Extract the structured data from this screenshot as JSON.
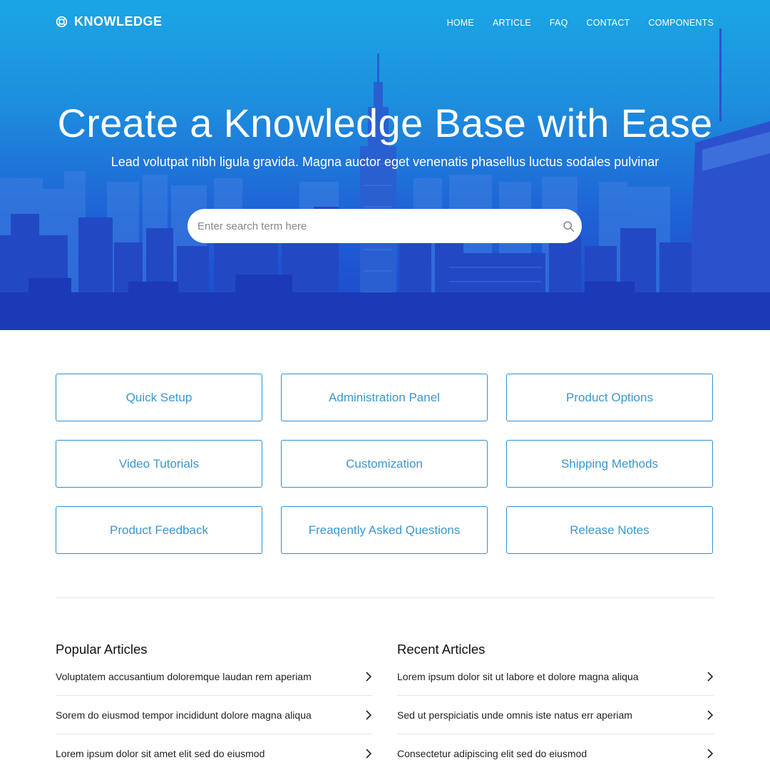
{
  "brand": {
    "name": "KNOWLEDGE"
  },
  "nav": {
    "items": [
      "HOME",
      "ARTICLE",
      "FAQ",
      "CONTACT",
      "COMPONENTS"
    ]
  },
  "hero": {
    "title": "Create a Knowledge Base with Ease",
    "subtitle": "Lead volutpat nibh ligula gravida. Magna auctor eget venenatis phasellus luctus sodales pulvinar",
    "search_placeholder": "Enter search term here"
  },
  "categories": [
    "Quick Setup",
    "Administration Panel",
    "Product Options",
    "Video Tutorials",
    "Customization",
    "Shipping Methods",
    "Product Feedback",
    "Freaqently Asked Questions",
    "Release Notes"
  ],
  "popular": {
    "title": "Popular Articles",
    "items": [
      "Voluptatem accusantium doloremque laudan rem aperiam",
      "Sorem do eiusmod tempor incididunt dolore magna aliqua",
      "Lorem ipsum dolor sit amet elit sed do eiusmod"
    ]
  },
  "recent": {
    "title": "Recent Articles",
    "items": [
      "Lorem ipsum dolor sit ut labore et dolore magna aliqua",
      "Sed ut perspiciatis unde omnis iste natus err aperiam",
      "Consectetur adipiscing elit sed do eiusmod"
    ]
  },
  "colors": {
    "accent": "#2f8fd6",
    "category_text": "#3b97cf",
    "hero_top": "#1aa6e6",
    "hero_bottom": "#1d45cc"
  },
  "icons": {
    "logo": "life-ring-icon",
    "search": "search-icon",
    "article_arrow": "chevron-right-icon"
  }
}
